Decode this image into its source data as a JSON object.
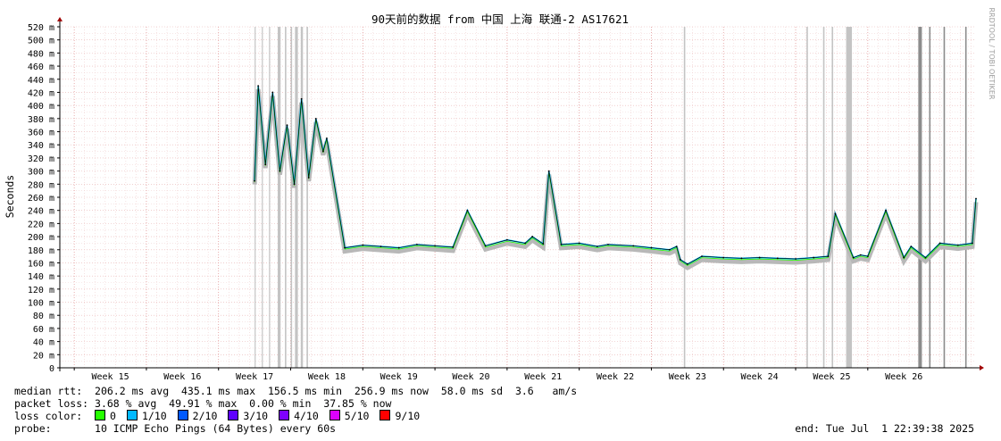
{
  "chart_data": {
    "type": "line",
    "title": "90天前的数据 from 中国 上海 联通-2 AS17621",
    "ylabel": "Seconds",
    "watermark": "RRDTOOL / TOBI OETIKER",
    "ylim": [
      0,
      520
    ],
    "y_ticks": [
      "0",
      "20 m",
      "40 m",
      "60 m",
      "80 m",
      "100 m",
      "120 m",
      "140 m",
      "160 m",
      "180 m",
      "200 m",
      "220 m",
      "240 m",
      "260 m",
      "280 m",
      "300 m",
      "320 m",
      "340 m",
      "360 m",
      "380 m",
      "400 m",
      "420 m",
      "440 m",
      "460 m",
      "480 m",
      "500 m",
      "520 m"
    ],
    "x_ticks": [
      "Week 15",
      "Week 16",
      "Week 17",
      "Week 18",
      "Week 19",
      "Week 20",
      "Week 21",
      "Week 22",
      "Week 23",
      "Week 24",
      "Week 25",
      "Week 26"
    ],
    "xlim": [
      14.3,
      27.0
    ],
    "grid": true,
    "series": [
      {
        "name": "median rtt",
        "x": [
          17.0,
          17.05,
          17.15,
          17.25,
          17.35,
          17.45,
          17.55,
          17.65,
          17.75,
          17.85,
          17.95,
          18.0,
          18.25,
          18.5,
          18.75,
          19.0,
          19.25,
          19.5,
          19.75,
          19.95,
          20.2,
          20.5,
          20.75,
          20.85,
          21.0,
          21.08,
          21.25,
          21.5,
          21.75,
          21.9,
          22.25,
          22.5,
          22.75,
          22.85,
          22.9,
          23.0,
          23.2,
          23.5,
          23.75,
          24.0,
          24.25,
          24.5,
          24.75,
          24.95,
          25.05,
          25.3,
          25.4,
          25.5,
          25.75,
          26.0,
          26.1,
          26.3,
          26.5,
          26.75,
          26.95,
          27.0
        ],
        "y": [
          285,
          430,
          310,
          420,
          300,
          370,
          280,
          410,
          290,
          380,
          330,
          350,
          183,
          187,
          185,
          183,
          188,
          186,
          184,
          240,
          186,
          195,
          190,
          200,
          189,
          300,
          188,
          190,
          185,
          188,
          186,
          183,
          180,
          185,
          165,
          158,
          170,
          168,
          167,
          168,
          167,
          166,
          168,
          170,
          235,
          168,
          172,
          170,
          240,
          168,
          185,
          168,
          190,
          187,
          190,
          258
        ]
      }
    ],
    "loss_shading_weeks": [
      [
        17.0,
        17.01
      ],
      [
        17.1,
        17.11
      ],
      [
        17.2,
        17.21
      ],
      [
        17.32,
        17.36
      ],
      [
        17.42,
        17.44
      ],
      [
        17.5,
        17.52
      ],
      [
        17.56,
        17.6
      ],
      [
        17.64,
        17.67
      ],
      [
        17.72,
        17.74
      ],
      [
        22.95,
        22.97
      ],
      [
        24.65,
        24.67
      ],
      [
        24.88,
        24.9
      ],
      [
        25.0,
        25.02
      ],
      [
        25.2,
        25.28
      ],
      [
        26.2,
        26.25
      ],
      [
        26.35,
        26.37
      ],
      [
        26.55,
        26.57
      ],
      [
        26.85,
        26.87
      ]
    ]
  },
  "stats": {
    "rtt_label": "median rtt:",
    "rtt_avg": "206.2 ms avg",
    "rtt_max": "435.1 ms max",
    "rtt_min": "156.5 ms min",
    "rtt_now": "256.9 ms now",
    "rtt_sd": "58.0 ms sd",
    "rtt_ams": "3.6   am/s",
    "loss_label": "packet loss:",
    "loss_avg": "3.68 % avg",
    "loss_max": "49.91 % max",
    "loss_min": "0.00 % min",
    "loss_now": "37.85 % now",
    "loss_color_label": "loss color:",
    "loss_colors": [
      {
        "label": "0",
        "color": "#26ff00"
      },
      {
        "label": "1/10",
        "color": "#00b8ff"
      },
      {
        "label": "2/10",
        "color": "#0059ff"
      },
      {
        "label": "3/10",
        "color": "#5e00ff"
      },
      {
        "label": "4/10",
        "color": "#7e00ff"
      },
      {
        "label": "5/10",
        "color": "#dd00ff"
      },
      {
        "label": "9/10",
        "color": "#ff0000"
      }
    ],
    "probe_label": "probe:",
    "probe_value": "10 ICMP Echo Pings (64 Bytes) every 60s",
    "end_label": "end: Tue Jul  1 22:39:38 2025"
  }
}
